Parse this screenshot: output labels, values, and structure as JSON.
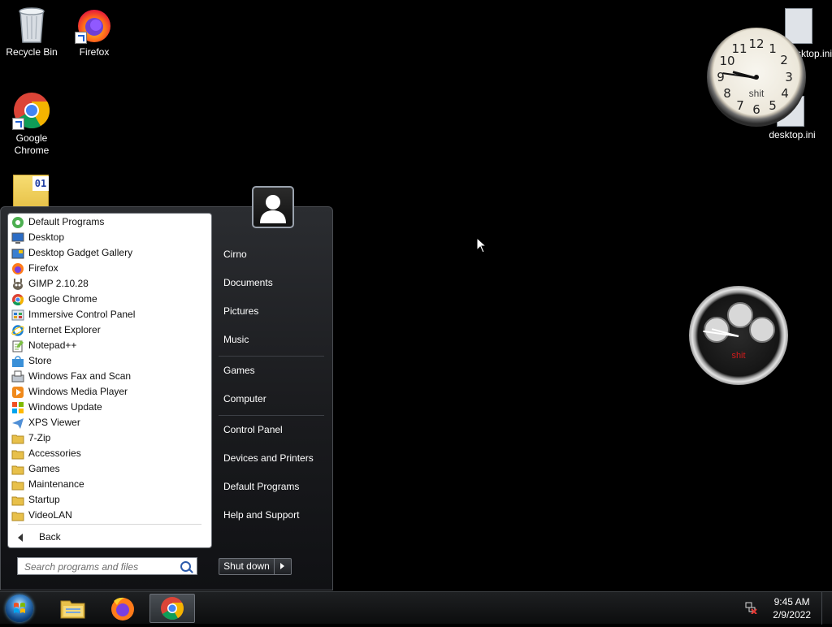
{
  "desktop": {
    "icons": [
      {
        "label": "Recycle Bin"
      },
      {
        "label": "Firefox"
      },
      {
        "label": "Google Chrome"
      }
    ],
    "files": [
      {
        "label": "desktop.ini"
      },
      {
        "label": "desktop.ini"
      }
    ],
    "binary_file_icon_text": "01"
  },
  "clock_gadget_1": {
    "numbers": [
      "12",
      "1",
      "2",
      "3",
      "4",
      "5",
      "6",
      "7",
      "8",
      "9",
      "10",
      "11"
    ],
    "text": "shit"
  },
  "clock_gadget_2": {
    "text": "shit"
  },
  "start_menu": {
    "programs": [
      {
        "label": "Default Programs",
        "icon": "default-programs-icon"
      },
      {
        "label": "Desktop",
        "icon": "desktop-icon"
      },
      {
        "label": "Desktop Gadget Gallery",
        "icon": "gadget-gallery-icon"
      },
      {
        "label": "Firefox",
        "icon": "firefox-icon"
      },
      {
        "label": "GIMP 2.10.28",
        "icon": "gimp-icon"
      },
      {
        "label": "Google Chrome",
        "icon": "chrome-icon"
      },
      {
        "label": "Immersive Control Panel",
        "icon": "control-panel-icon"
      },
      {
        "label": "Internet Explorer",
        "icon": "ie-icon"
      },
      {
        "label": "Notepad++",
        "icon": "notepad-icon"
      },
      {
        "label": "Store",
        "icon": "store-icon"
      },
      {
        "label": "Windows Fax and Scan",
        "icon": "fax-icon"
      },
      {
        "label": "Windows Media Player",
        "icon": "media-player-icon"
      },
      {
        "label": "Windows Update",
        "icon": "windows-update-icon"
      },
      {
        "label": "XPS Viewer",
        "icon": "xps-icon"
      },
      {
        "label": "7-Zip",
        "icon": "folder-icon"
      },
      {
        "label": "Accessories",
        "icon": "folder-icon"
      },
      {
        "label": "Games",
        "icon": "folder-icon"
      },
      {
        "label": "Maintenance",
        "icon": "folder-icon"
      },
      {
        "label": "Startup",
        "icon": "folder-icon"
      },
      {
        "label": "VideoLAN",
        "icon": "folder-icon"
      }
    ],
    "back_label": "Back",
    "search_placeholder": "Search programs and files",
    "right_items": [
      {
        "label": "Cirno"
      },
      {
        "label": "Documents"
      },
      {
        "label": "Pictures"
      },
      {
        "label": "Music"
      },
      {
        "label": "Games"
      },
      {
        "label": "Computer"
      },
      {
        "label": "Control Panel"
      },
      {
        "label": "Devices and Printers"
      },
      {
        "label": "Default Programs"
      },
      {
        "label": "Help and Support"
      }
    ],
    "shutdown_label": "Shut down"
  },
  "taskbar": {
    "time": "9:45 AM",
    "date": "2/9/2022",
    "items": [
      "file-explorer-icon",
      "firefox-icon",
      "chrome-icon"
    ]
  },
  "colors": {
    "desktop_bg": "#000000",
    "accent_blue": "#2c5bab"
  }
}
